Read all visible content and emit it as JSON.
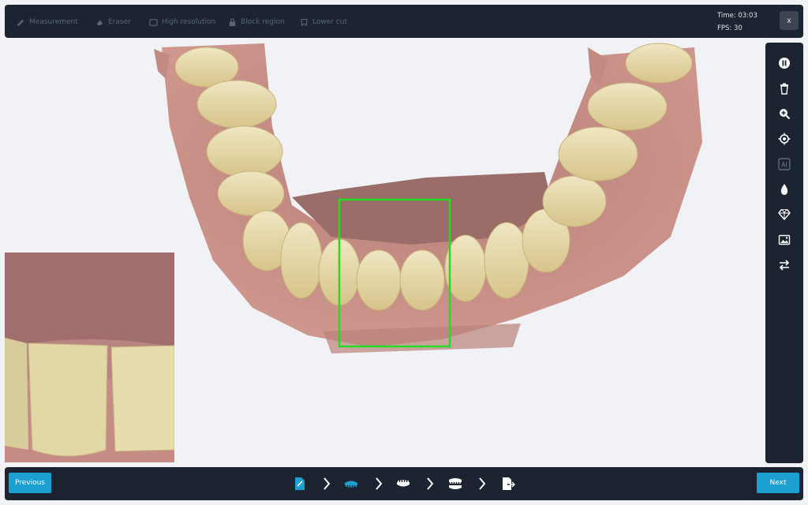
{
  "toolbar": {
    "tools": [
      {
        "label": "Measurement",
        "icon": "ruler-icon"
      },
      {
        "label": "Eraser",
        "icon": "eraser-icon"
      },
      {
        "label": "High resolution",
        "icon": "hd-icon"
      },
      {
        "label": "Block region",
        "icon": "lock-icon"
      },
      {
        "label": "Lower cut",
        "icon": "tooth-icon"
      }
    ],
    "time_label": "Time: 03:03",
    "fps_label": "FPS: 30",
    "close_label": "x"
  },
  "sidebar": {
    "icons": [
      "pause-icon",
      "trash-icon",
      "zoom-in-icon",
      "target-icon",
      "ai-icon",
      "drop-icon",
      "gem-icon",
      "image-icon",
      "swap-icon"
    ],
    "ai_label": "AI"
  },
  "workflow": {
    "steps": [
      "scan-setup-icon",
      "upper-jaw-icon",
      "lower-jaw-icon",
      "bite-icon",
      "export-icon"
    ],
    "active_step": 1
  },
  "nav": {
    "previous_label": "Previous",
    "next_label": "Next"
  },
  "colors": {
    "panel": "#1b2430",
    "accent": "#1e9fd4",
    "scan_box": "#22dd22",
    "gum": "#c98c84",
    "tooth": "#e6d9a8"
  }
}
